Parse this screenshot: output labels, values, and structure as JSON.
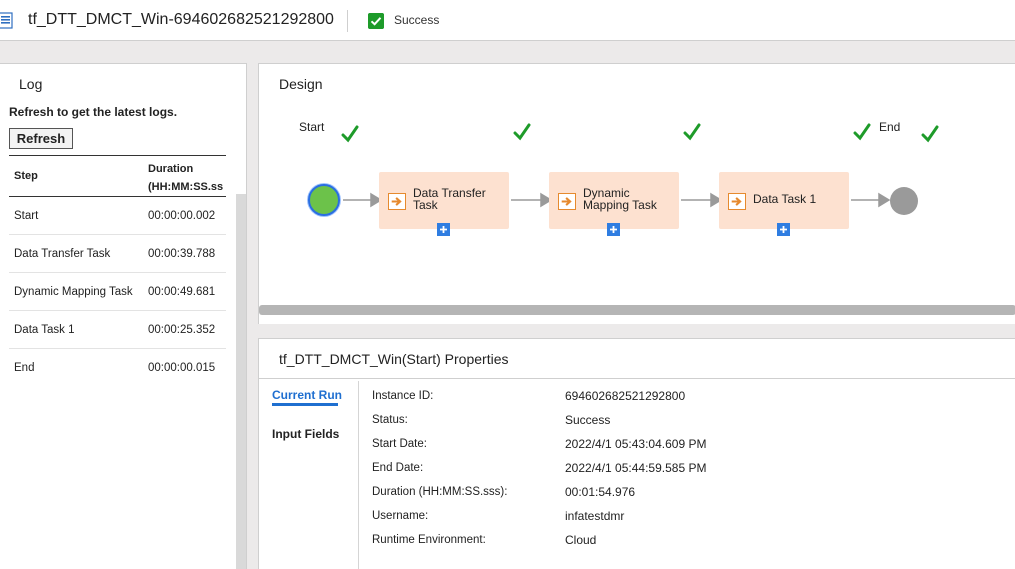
{
  "header": {
    "title": "tf_DTT_DMCT_Win-694602682521292800",
    "status": "Success"
  },
  "log": {
    "title": "Log",
    "refresh_note": "Refresh to get the latest logs.",
    "refresh_label": "Refresh",
    "columns": {
      "step": "Step",
      "duration_line1": "Duration",
      "duration_line2": "(HH:MM:SS.ss"
    },
    "rows": [
      {
        "step": "Start",
        "duration": "00:00:00.002"
      },
      {
        "step": "Data Transfer Task",
        "duration": "00:00:39.788"
      },
      {
        "step": "Dynamic Mapping Task",
        "duration": "00:00:49.681"
      },
      {
        "step": "Data Task 1",
        "duration": "00:00:25.352"
      },
      {
        "step": "End",
        "duration": "00:00:00.015"
      }
    ]
  },
  "design": {
    "title": "Design",
    "start_label": "Start",
    "end_label": "End",
    "tasks": [
      {
        "line1": "Data Transfer",
        "line2": "Task"
      },
      {
        "line1": "Dynamic",
        "line2": "Mapping Task"
      },
      {
        "line1": "Data Task 1",
        "line2": ""
      }
    ],
    "colors": {
      "task_fill": "#fde1d0",
      "start": "#6cc24a",
      "end": "#9a9a9a",
      "check": "#1e9b2a",
      "plus": "#2f7de1"
    }
  },
  "properties": {
    "title": "tf_DTT_DMCT_Win(Start) Properties",
    "tabs": {
      "current_run": "Current Run",
      "input_fields": "Input Fields"
    },
    "fields": [
      {
        "label": "Instance ID:",
        "value": "694602682521292800"
      },
      {
        "label": "Status:",
        "value": "Success"
      },
      {
        "label": "Start Date:",
        "value": "2022/4/1 05:43:04.609 PM"
      },
      {
        "label": "End Date:",
        "value": "2022/4/1 05:44:59.585 PM"
      },
      {
        "label": "Duration (HH:MM:SS.sss):",
        "value": "00:01:54.976"
      },
      {
        "label": "Username:",
        "value": "infatestdmr"
      },
      {
        "label": "Runtime Environment:",
        "value": "Cloud"
      }
    ]
  }
}
